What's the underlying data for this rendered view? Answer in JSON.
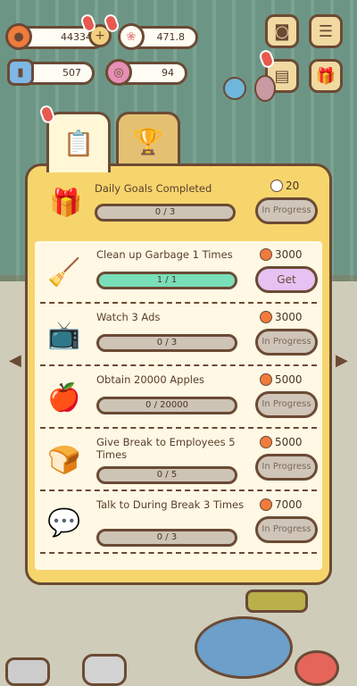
{
  "topbar": {
    "apples": "44334",
    "paws": "471.8",
    "tickets": "507",
    "yarn": "94"
  },
  "tabs": [
    {
      "name": "daily-goals-tab",
      "icon": "clipboard-carrot-icon",
      "active": true
    },
    {
      "name": "achievements-tab",
      "icon": "trophy-icon",
      "active": false
    }
  ],
  "header": {
    "title": "Daily Goals Completed",
    "progress_text": "0 / 3",
    "reward": "20",
    "button": "In Progress"
  },
  "tasks": [
    {
      "title": "Clean up Garbage 1 Times",
      "progress_text": "1 / 1",
      "progress": 1.0,
      "reward": "3000",
      "button": "Get",
      "icon": "broom-icon"
    },
    {
      "title": "Watch 3 Ads",
      "progress_text": "0 / 3",
      "progress": 0,
      "reward": "3000",
      "button": "In Progress",
      "icon": "tv-ad-icon"
    },
    {
      "title": "Obtain 20000 Apples",
      "progress_text": "0 / 20000",
      "progress": 0,
      "reward": "5000",
      "button": "In Progress",
      "icon": "apple-icon"
    },
    {
      "title": "Give Break to Employees 5 Times",
      "progress_text": "0 / 5",
      "progress": 0,
      "reward": "5000",
      "button": "In Progress",
      "icon": "bread-icon"
    },
    {
      "title": "Talk to During Break 3 Times",
      "progress_text": "0 / 3",
      "progress": 0,
      "reward": "7000",
      "button": "In Progress",
      "icon": "chat-bubble-icon"
    }
  ],
  "colors": {
    "panel": "#f7d56d",
    "panel_body": "#fff8e4",
    "outline": "#6b4a35",
    "progress_fill": "#79dfb8",
    "get_button": "#e5c2f1"
  }
}
